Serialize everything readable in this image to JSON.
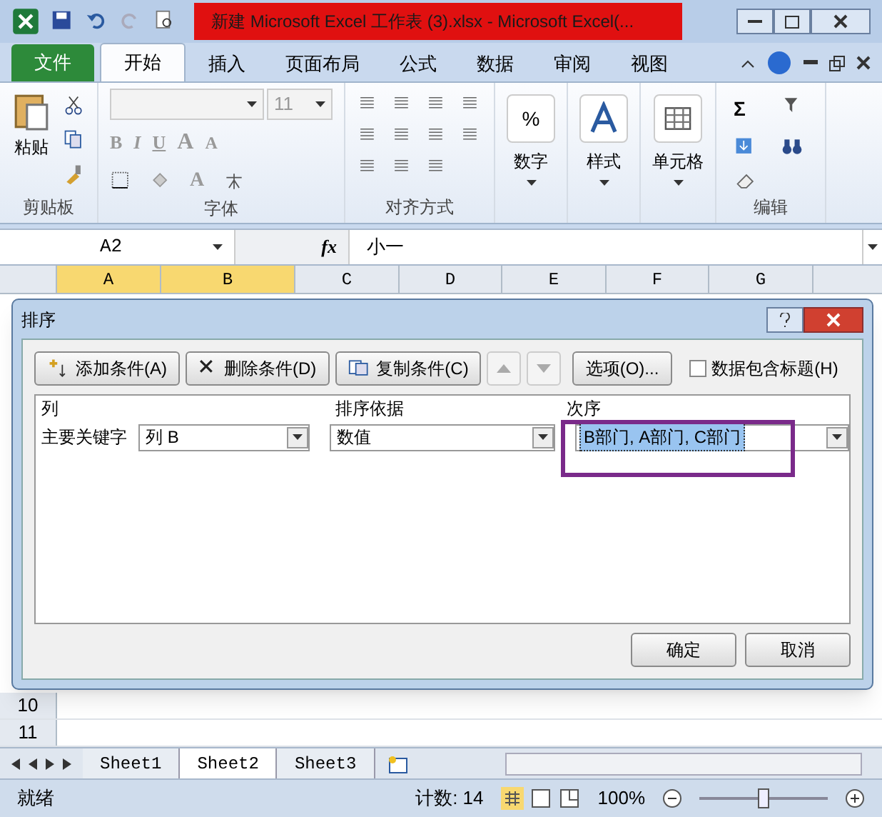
{
  "window": {
    "title": "新建 Microsoft Excel 工作表 (3).xlsx - Microsoft Excel(..."
  },
  "ribbon_tabs": [
    {
      "label": "文件",
      "kind": "file",
      "selected": false
    },
    {
      "label": "开始",
      "kind": "tab",
      "selected": true
    },
    {
      "label": "插入",
      "kind": "tab",
      "selected": false
    },
    {
      "label": "页面布局",
      "kind": "tab",
      "selected": false
    },
    {
      "label": "公式",
      "kind": "tab",
      "selected": false
    },
    {
      "label": "数据",
      "kind": "tab",
      "selected": false
    },
    {
      "label": "审阅",
      "kind": "tab",
      "selected": false
    },
    {
      "label": "视图",
      "kind": "tab",
      "selected": false
    }
  ],
  "ribbon_groups": [
    {
      "kind": "clipboard",
      "label": "剪贴板",
      "button": "粘贴"
    },
    {
      "kind": "font",
      "label": "字体",
      "font_size": "11",
      "format_buttons": [
        "B",
        "I",
        "U",
        "A",
        "A"
      ],
      "font_color": "A"
    },
    {
      "kind": "alignment",
      "label": "对齐方式"
    },
    {
      "kind": "number",
      "button": "数字",
      "symbol": "%"
    },
    {
      "kind": "styles",
      "button": "样式"
    },
    {
      "kind": "cells",
      "button": "单元格"
    },
    {
      "kind": "editing",
      "label": "编辑",
      "symbol": "Σ"
    }
  ],
  "formula_bar": {
    "name_box": "A2",
    "function_symbol": "fx",
    "value": "小一"
  },
  "column_headers": [
    {
      "label": "A",
      "selected": true
    },
    {
      "label": "B",
      "selected": true
    },
    {
      "label": "C",
      "selected": false
    },
    {
      "label": "D",
      "selected": false
    },
    {
      "label": "E",
      "selected": false
    },
    {
      "label": "F",
      "selected": false
    },
    {
      "label": "G",
      "selected": false
    }
  ],
  "row_headers": [
    "10",
    "11"
  ],
  "dialog": {
    "title": "排序",
    "toolbar": [
      {
        "kind": "add",
        "label": "添加条件(A)"
      },
      {
        "kind": "delete",
        "label": "删除条件(D)"
      },
      {
        "kind": "copy",
        "label": "复制条件(C)"
      },
      {
        "kind": "up"
      },
      {
        "kind": "down"
      },
      {
        "kind": "options",
        "label": "选项(O)..."
      }
    ],
    "header_checkbox": {
      "label": "数据包含标题(H)",
      "checked": false
    },
    "columns": [
      "列",
      "排序依据",
      "次序"
    ],
    "rows": [
      {
        "label": "主要关键字",
        "column": "列 B",
        "sort_on": "数值",
        "order": "B部门, A部门, C部门",
        "selected": true
      }
    ],
    "buttons": [
      "确定",
      "取消"
    ]
  },
  "sheet_tabs": [
    {
      "label": "Sheet1",
      "selected": false
    },
    {
      "label": "Sheet2",
      "selected": true
    },
    {
      "label": "Sheet3",
      "selected": false
    }
  ],
  "status_bar": {
    "status": "就绪",
    "count": "计数: 14",
    "zoom": "100%",
    "level": 0.5
  }
}
